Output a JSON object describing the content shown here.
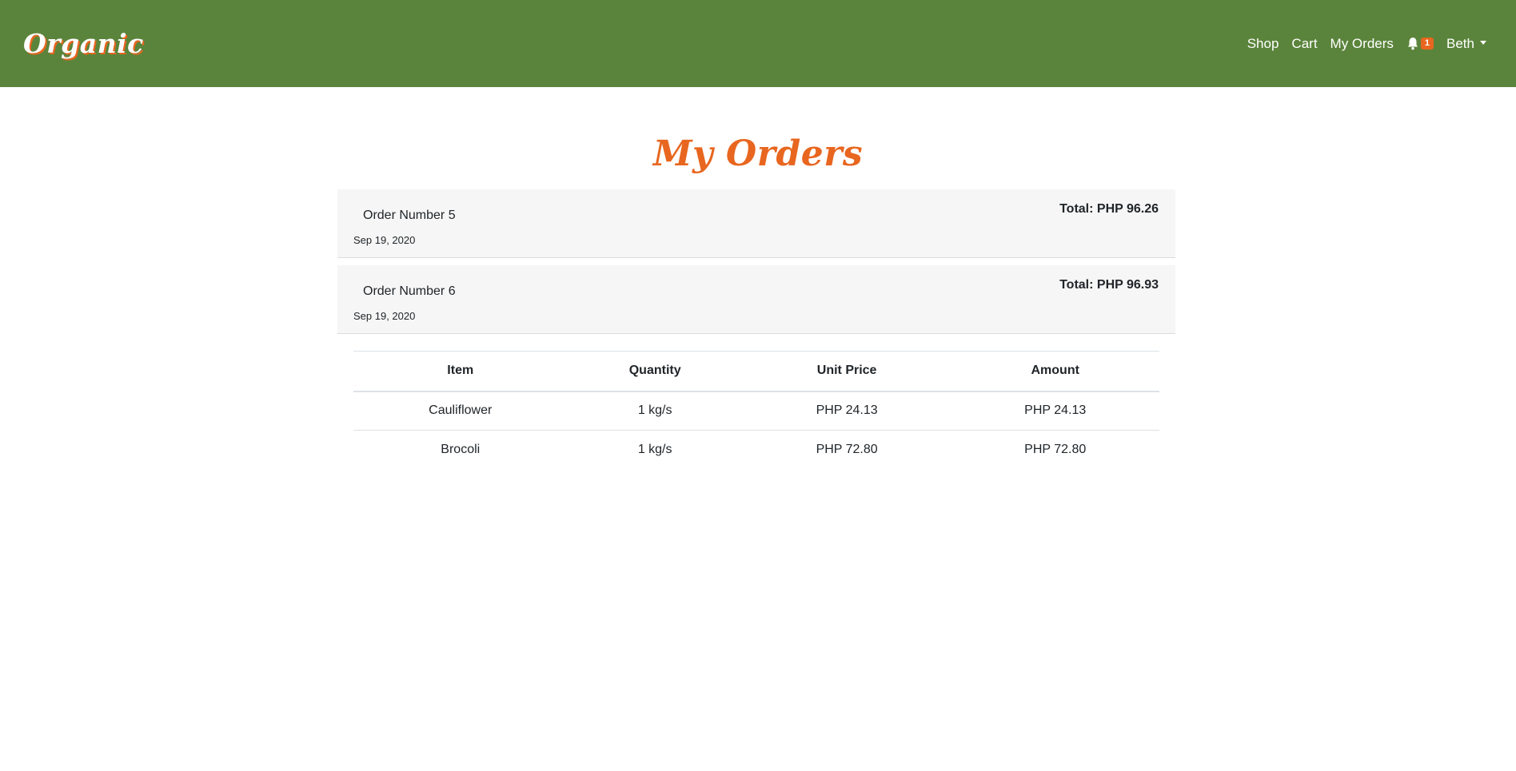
{
  "navbar": {
    "brand": "Organic",
    "links": {
      "shop": "Shop",
      "cart": "Cart",
      "my_orders": "My Orders"
    },
    "notification_count": "1",
    "user_name": "Beth"
  },
  "page": {
    "title": "My Orders"
  },
  "orders": [
    {
      "number": "Order Number 5",
      "date": "Sep 19, 2020",
      "total": "Total: PHP 96.26"
    },
    {
      "number": "Order Number 6",
      "date": "Sep 19, 2020",
      "total": "Total: PHP 96.93"
    }
  ],
  "order_items": {
    "headers": [
      "Item",
      "Quantity",
      "Unit Price",
      "Amount"
    ],
    "rows": [
      [
        "Cauliflower",
        "1 kg/s",
        "PHP 24.13",
        "PHP 24.13"
      ],
      [
        "Brocoli",
        "1 kg/s",
        "PHP 72.80",
        "PHP 72.80"
      ]
    ]
  },
  "colors": {
    "navbar": "#5a843b",
    "accent": "#e8661f",
    "card": "#f6f6f6"
  },
  "icons": {
    "notifications": "bell-icon",
    "user_menu": "caret-down-icon"
  }
}
